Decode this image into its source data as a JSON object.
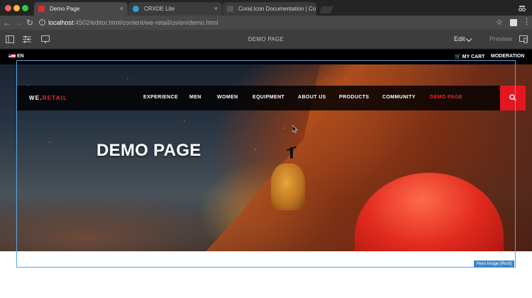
{
  "browser": {
    "tabs": [
      {
        "title": "Demo Page",
        "favicon_color": "#e02b28",
        "active": true
      },
      {
        "title": "CRXDE Lite",
        "favicon_color": "#2aa0d8",
        "active": false
      },
      {
        "title": "Coral.Icon Documentation | Co",
        "favicon_color": "#555555",
        "active": false
      }
    ],
    "tab_close_glyph": "×",
    "url_host": "localhost",
    "url_path": ":4502/editor.html/content/we-retail/us/en/demo.html"
  },
  "editor": {
    "page_title": "DEMO PAGE",
    "mode_label": "Edit",
    "preview_label": "Preview"
  },
  "site": {
    "language": "EN",
    "cart_label": "MY CART",
    "moderation_label": "MODERATION",
    "logo_main": "WE.",
    "logo_accent": "RETAIL",
    "nav": [
      {
        "label": "EXPERIENCE"
      },
      {
        "label": "MEN"
      },
      {
        "label": "WOMEN"
      },
      {
        "label": "EQUIPMENT"
      },
      {
        "label": "ABOUT US"
      },
      {
        "label": "PRODUCTS"
      },
      {
        "label": "COMMUNITY"
      },
      {
        "label": "DEMO PAGE",
        "active": true
      }
    ],
    "hero_title": "DEMO PAGE"
  },
  "selection": {
    "component_label": "Hero Image [Root]",
    "color": "#58a6e6"
  },
  "colors": {
    "brand_red": "#e5161f",
    "accent_text_red": "#ea2b24"
  }
}
